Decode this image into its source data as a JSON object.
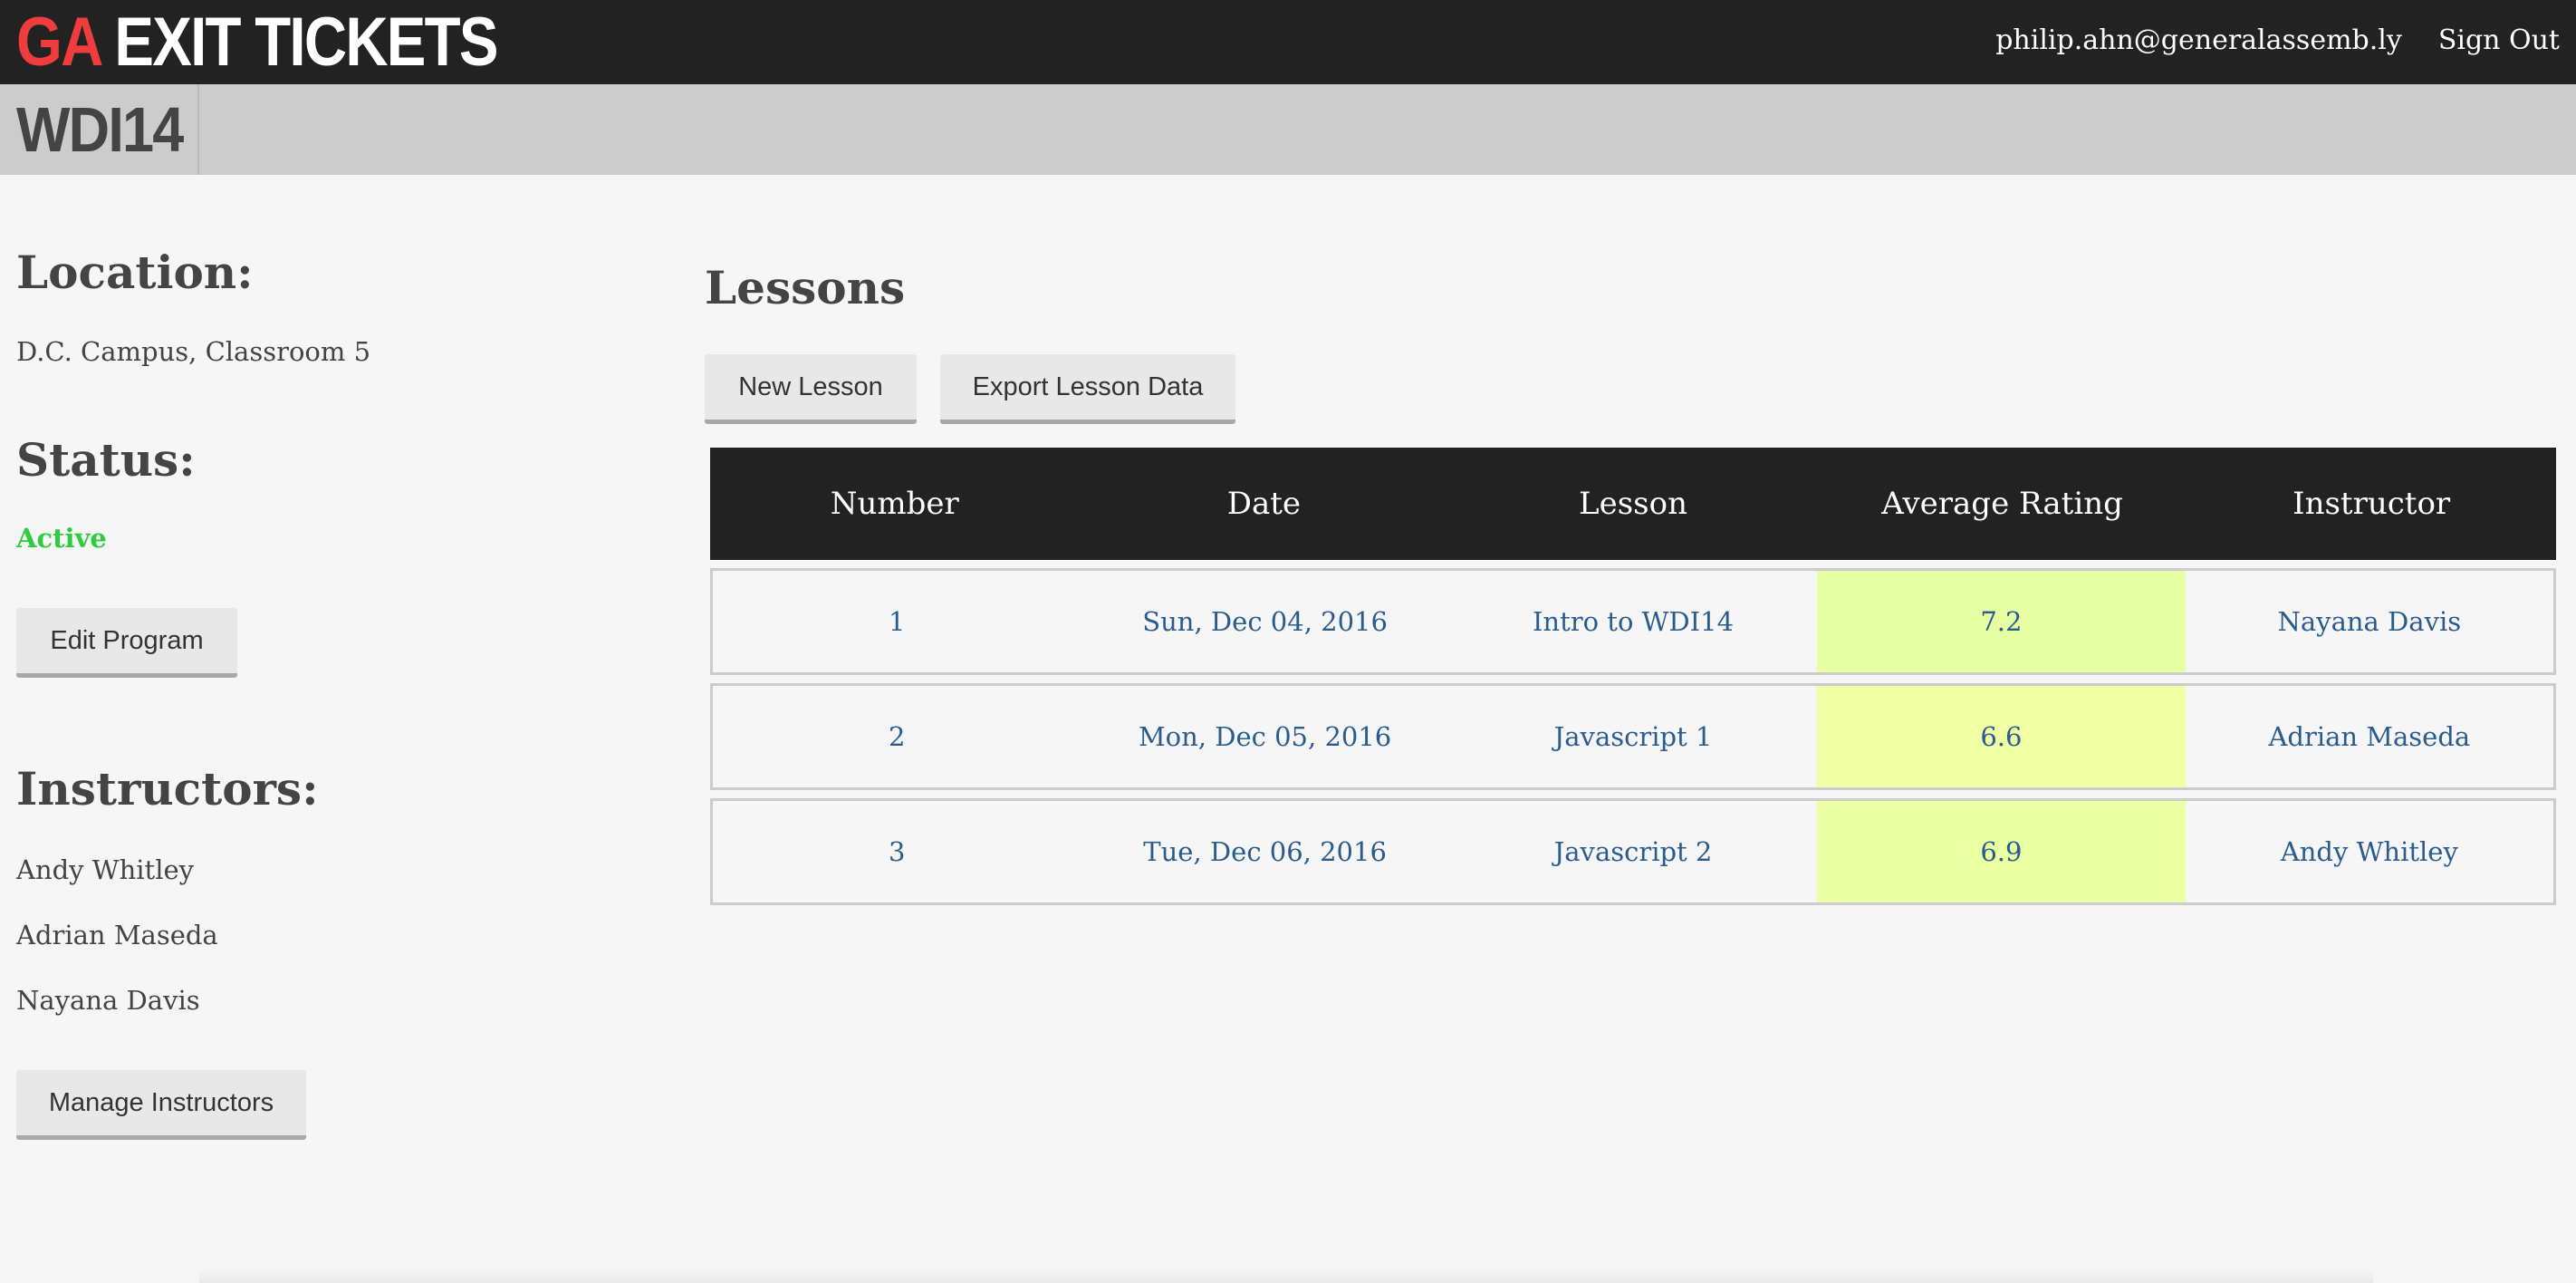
{
  "header": {
    "brand_ga": "GA",
    "brand_rest": "EXIT TICKETS",
    "user_email": "philip.ahn@generalassemb.ly",
    "sign_out": "Sign Out"
  },
  "program": {
    "code": "WDI14"
  },
  "sidebar": {
    "location_heading": "Location:",
    "location_value": "D.C. Campus, Classroom 5",
    "status_heading": "Status:",
    "status_value": "Active",
    "edit_program_label": "Edit Program",
    "instructors_heading": "Instructors:",
    "instructors": [
      "Andy Whitley",
      "Adrian Maseda",
      "Nayana Davis"
    ],
    "manage_instructors_label": "Manage Instructors"
  },
  "main": {
    "lessons_title": "Lessons",
    "new_lesson_label": "New Lesson",
    "export_label": "Export Lesson Data",
    "table": {
      "headers": [
        "Number",
        "Date",
        "Lesson",
        "Average Rating",
        "Instructor"
      ],
      "rows": [
        {
          "number": "1",
          "date": "Sun, Dec 04, 2016",
          "lesson": "Intro to WDI14",
          "rating": "7.2",
          "rating_color": "#e6ffa3",
          "instructor": "Nayana Davis"
        },
        {
          "number": "2",
          "date": "Mon, Dec 05, 2016",
          "lesson": "Javascript 1",
          "rating": "6.6",
          "rating_color": "#f0ffa3",
          "instructor": "Adrian Maseda"
        },
        {
          "number": "3",
          "date": "Tue, Dec 06, 2016",
          "lesson": "Javascript 2",
          "rating": "6.9",
          "rating_color": "#ebffa3",
          "instructor": "Andy Whitley"
        }
      ]
    }
  },
  "colors": {
    "topbar": "#222222",
    "brand_red": "#ef3d3d",
    "status_green": "#2ecc40",
    "link_blue": "#2a5d8f"
  }
}
